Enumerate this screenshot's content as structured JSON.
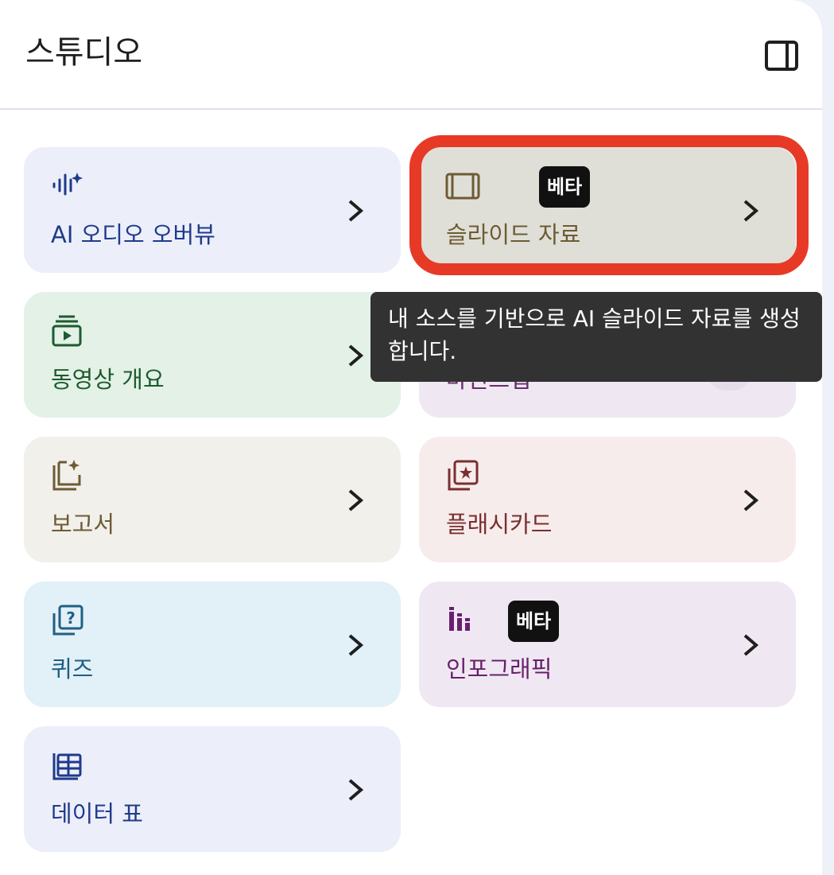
{
  "header": {
    "title": "스튜디오"
  },
  "cards": [
    {
      "label": "AI 오디오 오버뷰",
      "icon": "audio-waveform-sparkle-icon",
      "color": "#1f3a8a",
      "bg": "#eceefa"
    },
    {
      "label": "슬라이드 자료",
      "icon": "slides-icon",
      "color": "#6d5b35",
      "bg": "#e0dfd7",
      "badge": "베타"
    },
    {
      "label": "동영상 개요",
      "icon": "video-overview-icon",
      "color": "#1e5b2e",
      "bg": "#e3f1e7"
    },
    {
      "label": "마인드맵",
      "icon": "mind-map-icon",
      "color": "#6a2b6e",
      "bg": "#efe8f2"
    },
    {
      "label": "보고서",
      "icon": "report-sparkle-icon",
      "color": "#6d5b35",
      "bg": "#f1f0eb"
    },
    {
      "label": "플래시카드",
      "icon": "flashcard-icon",
      "color": "#7a2f2f",
      "bg": "#f7ecec"
    },
    {
      "label": "퀴즈",
      "icon": "quiz-icon",
      "color": "#205e86",
      "bg": "#e2f0f7"
    },
    {
      "label": "인포그래픽",
      "icon": "infographic-icon",
      "color": "#6a1f6e",
      "bg": "#efe8f2",
      "badge": "베타"
    },
    {
      "label": "데이터 표",
      "icon": "data-table-icon",
      "color": "#1f3a8a",
      "bg": "#eceefa"
    }
  ],
  "tooltip": {
    "text": "내 소스를 기반으로 AI 슬라이드 자료를 생성합니다."
  }
}
